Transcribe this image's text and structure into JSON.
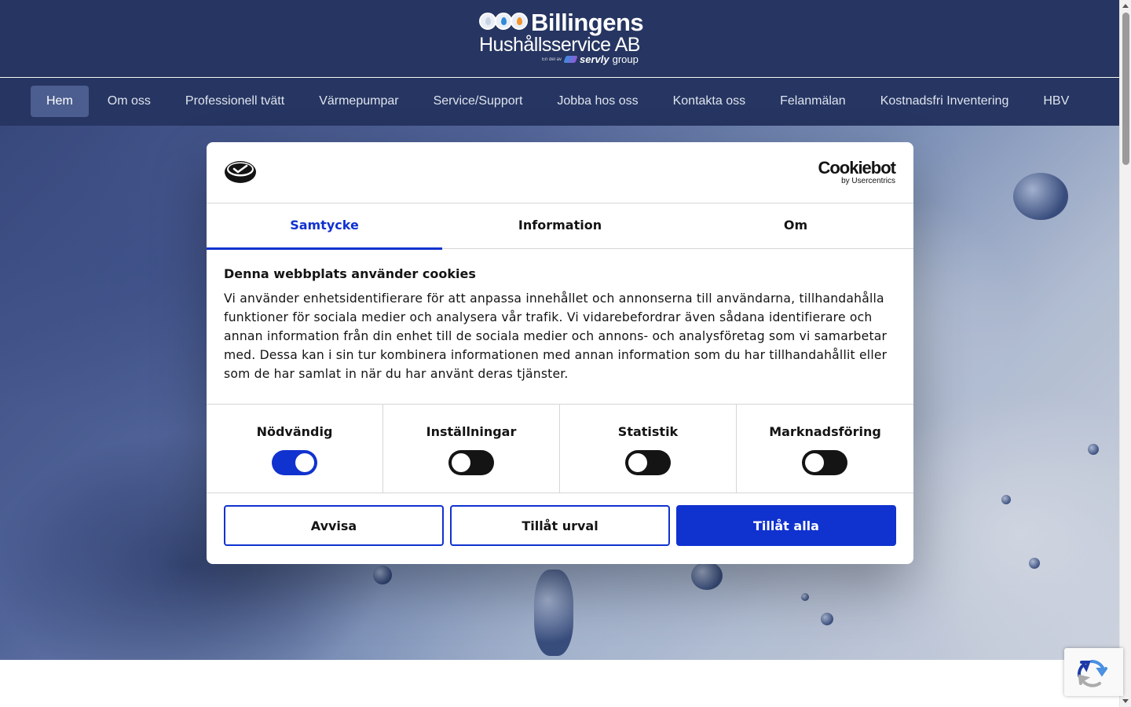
{
  "header": {
    "logo": {
      "name": "Billingens",
      "subtitle": "Hushållsservice AB",
      "group_prefix": "En del av",
      "group_brand": "servly",
      "group_suffix": "group"
    }
  },
  "nav": {
    "items": [
      {
        "label": "Hem",
        "active": true
      },
      {
        "label": "Om oss"
      },
      {
        "label": "Professionell tvätt"
      },
      {
        "label": "Värmepumpar"
      },
      {
        "label": "Service/Support"
      },
      {
        "label": "Jobba hos oss"
      },
      {
        "label": "Kontakta oss"
      },
      {
        "label": "Felanmälan"
      },
      {
        "label": "Kostnadsfri Inventering"
      },
      {
        "label": "HBV"
      }
    ]
  },
  "cookie_dialog": {
    "brand": {
      "name": "Cookiebot",
      "by": "by Usercentrics"
    },
    "tabs": [
      {
        "label": "Samtycke",
        "active": true
      },
      {
        "label": "Information"
      },
      {
        "label": "Om"
      }
    ],
    "title": "Denna webbplats använder cookies",
    "body": "Vi använder enhetsidentifierare för att anpassa innehållet och annonserna till användarna, tillhandahålla funktioner för sociala medier och analysera vår trafik. Vi vidarebefordrar även sådana identifierare och annan information från din enhet till de sociala medier och annons- och analysföretag som vi samarbetar med. Dessa kan i sin tur kombinera informationen med annan information som du har tillhandahållit eller som de har samlat in när du har använt deras tjänster.",
    "categories": [
      {
        "label": "Nödvändig",
        "enabled": true
      },
      {
        "label": "Inställningar",
        "enabled": false
      },
      {
        "label": "Statistik",
        "enabled": false
      },
      {
        "label": "Marknadsföring",
        "enabled": false
      }
    ],
    "buttons": {
      "reject": "Avvisa",
      "allow_selection": "Tillåt urval",
      "allow_all": "Tillåt alla"
    }
  },
  "colors": {
    "header_bg": "#263561",
    "nav_active_bg": "#4c5e8f",
    "accent": "#1032cf",
    "toggle_off": "#141414"
  }
}
